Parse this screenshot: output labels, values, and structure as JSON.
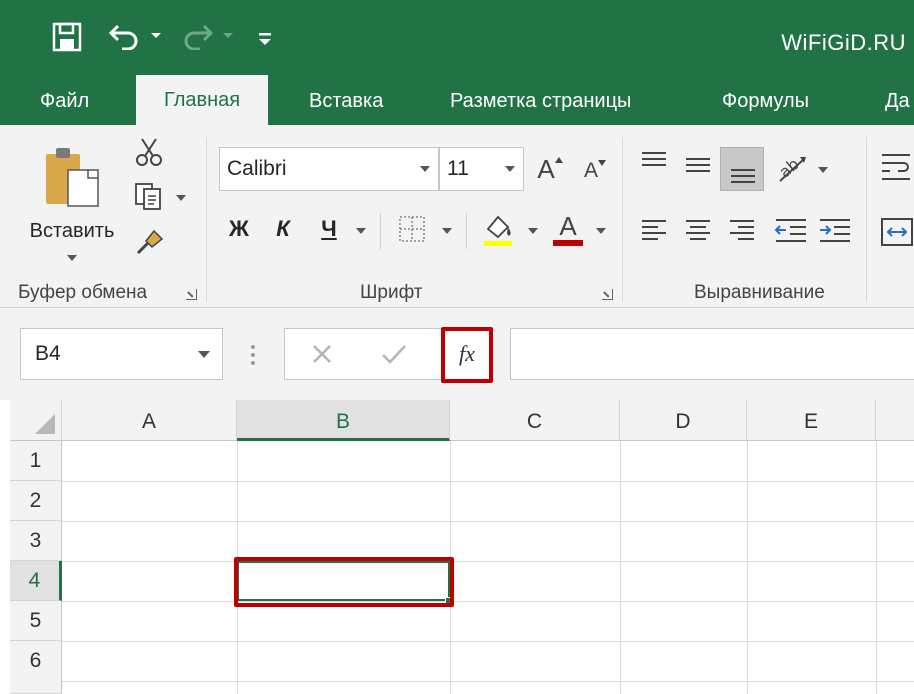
{
  "brand": "WiFiGiD.RU",
  "tabs": [
    "Файл",
    "Главная",
    "Вставка",
    "Разметка страницы",
    "Формулы",
    "Да"
  ],
  "clipboard": {
    "paste_label": "Вставить",
    "group_label": "Буфер обмена"
  },
  "font": {
    "name": "Calibri",
    "size": "11",
    "bold": "Ж",
    "italic": "К",
    "underline": "Ч",
    "grow": "A",
    "shrink": "A",
    "color_letter": "A",
    "group_label": "Шрифт"
  },
  "alignment": {
    "group_label": "Выравнивание"
  },
  "formula_bar": {
    "name_box": "B4",
    "fx": "fx",
    "value": ""
  },
  "grid": {
    "columns": [
      "A",
      "B",
      "C",
      "D",
      "E"
    ],
    "rows": [
      "1",
      "2",
      "3",
      "4",
      "5",
      "6"
    ],
    "selected_column": "B",
    "selected_row": "4"
  },
  "colors": {
    "accent": "#217346",
    "highlight": "#c00000",
    "font_color_bar": "#c00000"
  }
}
